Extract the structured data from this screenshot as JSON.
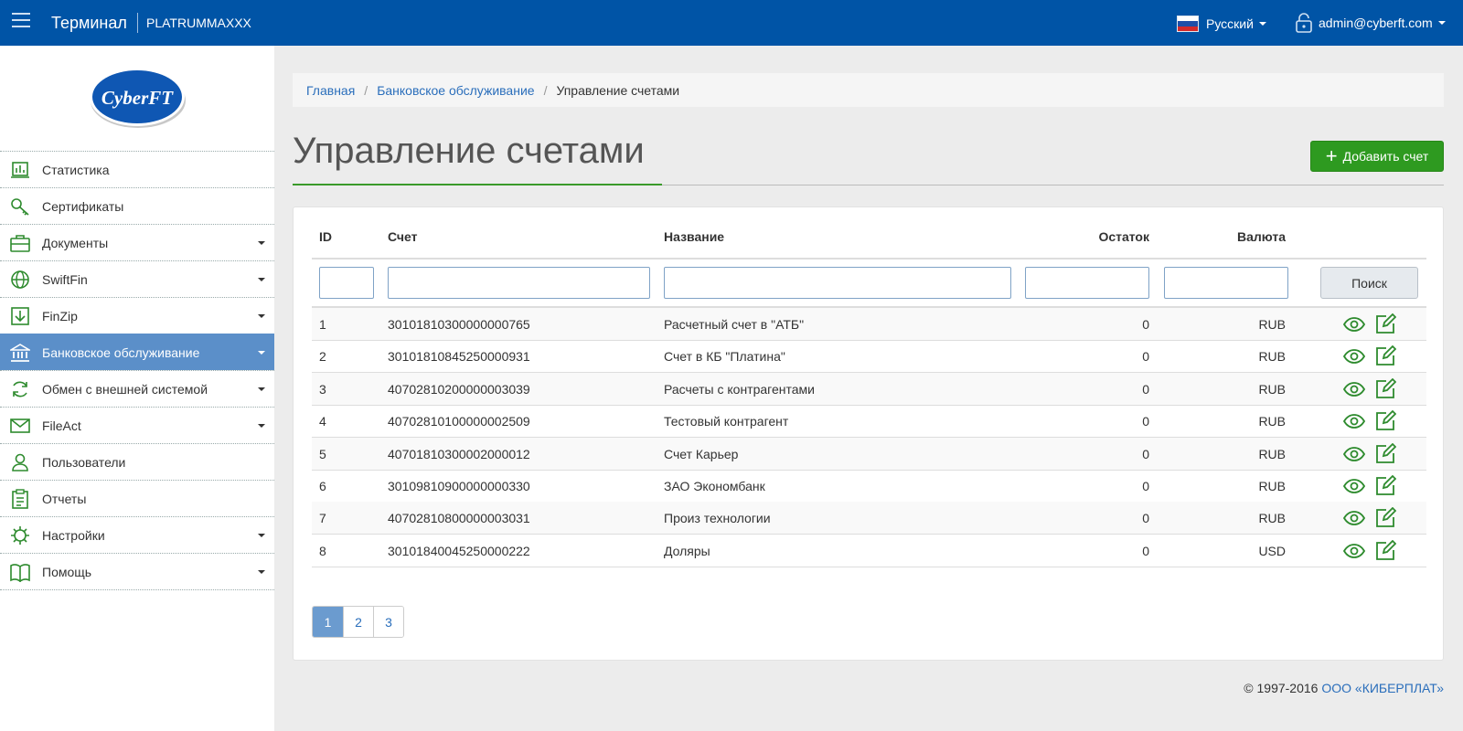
{
  "header": {
    "brand": "Терминал",
    "terminal_id": "PLATRUMMAXXX",
    "language": "Русский",
    "user_email": "admin@cyberft.com"
  },
  "logo": {
    "text": "CyberFT"
  },
  "sidebar": {
    "items": [
      {
        "label": "Статистика",
        "icon": "chart-icon",
        "submenu": false,
        "active": false
      },
      {
        "label": "Сертификаты",
        "icon": "key-icon",
        "submenu": false,
        "active": false
      },
      {
        "label": "Документы",
        "icon": "briefcase-icon",
        "submenu": true,
        "active": false
      },
      {
        "label": "SwiftFin",
        "icon": "globe-icon",
        "submenu": true,
        "active": false
      },
      {
        "label": "FinZip",
        "icon": "download-box-icon",
        "submenu": true,
        "active": false
      },
      {
        "label": "Банковское обслуживание",
        "icon": "bank-icon",
        "submenu": true,
        "active": true
      },
      {
        "label": "Обмен с внешней системой",
        "icon": "sync-icon",
        "submenu": true,
        "active": false
      },
      {
        "label": "FileAct",
        "icon": "envelope-icon",
        "submenu": true,
        "active": false
      },
      {
        "label": "Пользователи",
        "icon": "user-icon",
        "submenu": false,
        "active": false
      },
      {
        "label": "Отчеты",
        "icon": "clipboard-icon",
        "submenu": false,
        "active": false
      },
      {
        "label": "Настройки",
        "icon": "gear-icon",
        "submenu": true,
        "active": false
      },
      {
        "label": "Помощь",
        "icon": "book-icon",
        "submenu": true,
        "active": false
      }
    ]
  },
  "breadcrumb": {
    "home": "Главная",
    "section": "Банковское обслуживание",
    "current": "Управление счетами"
  },
  "page": {
    "title": "Управление счетами",
    "add_button": "Добавить счет"
  },
  "table": {
    "columns": {
      "id": "ID",
      "account": "Счет",
      "name": "Название",
      "balance": "Остаток",
      "currency": "Валюта"
    },
    "search_button": "Поиск",
    "filters": {
      "id": "",
      "account": "",
      "name": "",
      "balance": "",
      "currency": ""
    },
    "rows": [
      {
        "id": "1",
        "account": "30101810300000000765",
        "name": "Расчетный счет в \"АТБ\"",
        "balance": "0",
        "currency": "RUB"
      },
      {
        "id": "2",
        "account": "30101810845250000931",
        "name": "Счет в КБ \"Платина\"",
        "balance": "0",
        "currency": "RUB"
      },
      {
        "id": "3",
        "account": "40702810200000003039",
        "name": "Расчеты с контрагентами",
        "balance": "0",
        "currency": "RUB"
      },
      {
        "id": "4",
        "account": "40702810100000002509",
        "name": "Тестовый контрагент",
        "balance": "0",
        "currency": "RUB"
      },
      {
        "id": "5",
        "account": "40701810300002000012",
        "name": "Счет Карьер",
        "balance": "0",
        "currency": "RUB"
      },
      {
        "id": "6",
        "account": "30109810900000000330",
        "name": "ЗАО Экономбанк",
        "balance": "0",
        "currency": "RUB"
      },
      {
        "id": "7",
        "account": "40702810800000003031",
        "name": "Произ технологии",
        "balance": "0",
        "currency": "RUB"
      },
      {
        "id": "8",
        "account": "30101840045250000222",
        "name": "Доляры",
        "balance": "0",
        "currency": "USD"
      }
    ]
  },
  "pagination": {
    "pages": [
      "1",
      "2",
      "3"
    ],
    "current": "1"
  },
  "footer": {
    "copyright": "© 1997-2016",
    "company": "ООО «КИБЕРПЛАТ»"
  },
  "colors": {
    "header": "#0054a6",
    "accent_green": "#2e9a20",
    "active_menu": "#5b8fc9",
    "link": "#2a6ebb"
  }
}
